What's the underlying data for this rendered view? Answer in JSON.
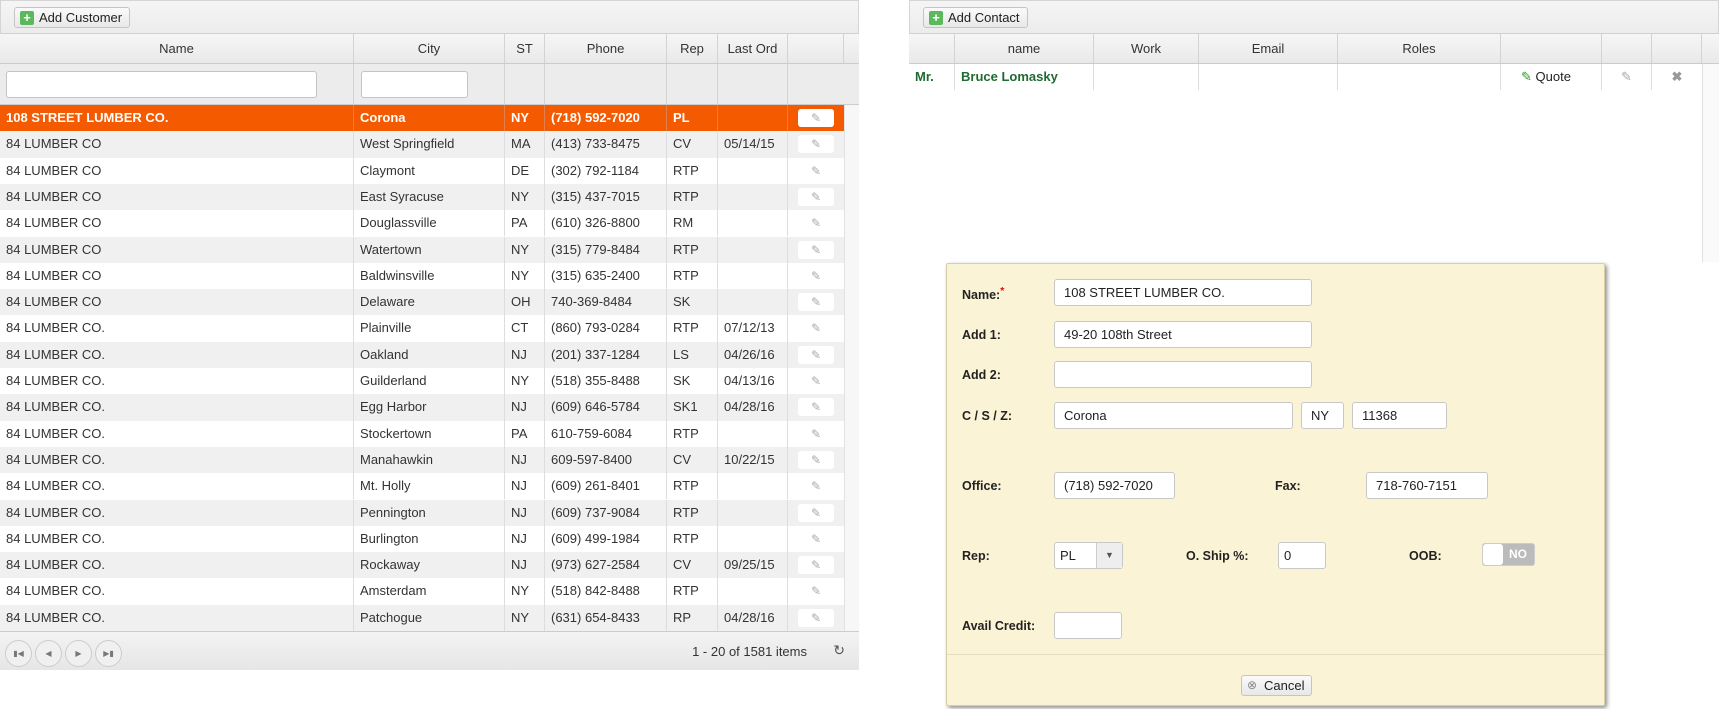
{
  "customers": {
    "add_label": "Add Customer",
    "columns": [
      "Name",
      "City",
      "ST",
      "Phone",
      "Rep",
      "Last Ord"
    ],
    "rows": [
      [
        "108 STREET LUMBER CO.",
        "Corona",
        "NY",
        "(718) 592-7020",
        "PL",
        ""
      ],
      [
        "84 LUMBER CO",
        "West Springfield",
        "MA",
        "(413) 733-8475",
        "CV",
        "05/14/15"
      ],
      [
        "84 LUMBER CO",
        "Claymont",
        "DE",
        "(302) 792-1184",
        "RTP",
        ""
      ],
      [
        "84 LUMBER CO",
        "East Syracuse",
        "NY",
        "(315) 437-7015",
        "RTP",
        ""
      ],
      [
        "84 LUMBER CO",
        "Douglassville",
        "PA",
        "(610) 326-8800",
        "RM",
        ""
      ],
      [
        "84 LUMBER CO",
        "Watertown",
        "NY",
        "(315) 779-8484",
        "RTP",
        ""
      ],
      [
        "84 LUMBER CO",
        "Baldwinsville",
        "NY",
        "(315) 635-2400",
        "RTP",
        ""
      ],
      [
        "84 LUMBER CO",
        "Delaware",
        "OH",
        "740-369-8484",
        "SK",
        ""
      ],
      [
        "84 LUMBER CO.",
        "Plainville",
        "CT",
        "(860) 793-0284",
        "RTP",
        "07/12/13"
      ],
      [
        "84 LUMBER CO.",
        "Oakland",
        "NJ",
        "(201) 337-1284",
        "LS",
        "04/26/16"
      ],
      [
        "84 LUMBER CO.",
        "Guilderland",
        "NY",
        "(518) 355-8488",
        "SK",
        "04/13/16"
      ],
      [
        "84 LUMBER CO.",
        "Egg Harbor",
        "NJ",
        "(609) 646-5784",
        "SK1",
        "04/28/16"
      ],
      [
        "84 LUMBER CO.",
        "Stockertown",
        "PA",
        "610-759-6084",
        "RTP",
        ""
      ],
      [
        "84 LUMBER CO.",
        "Manahawkin",
        "NJ",
        "609-597-8400",
        "CV",
        "10/22/15"
      ],
      [
        "84 LUMBER CO.",
        "Mt. Holly",
        "NJ",
        "(609) 261-8401",
        "RTP",
        ""
      ],
      [
        "84 LUMBER CO.",
        "Pennington",
        "NJ",
        "(609) 737-9084",
        "RTP",
        ""
      ],
      [
        "84 LUMBER CO.",
        "Burlington",
        "NJ",
        "(609) 499-1984",
        "RTP",
        ""
      ],
      [
        "84 LUMBER CO.",
        "Rockaway",
        "NJ",
        "(973) 627-2584",
        "CV",
        "09/25/15"
      ],
      [
        "84 LUMBER CO.",
        "Amsterdam",
        "NY",
        "(518) 842-8488",
        "RTP",
        ""
      ],
      [
        "84 LUMBER CO.",
        "Patchogue",
        "NY",
        "(631) 654-8433",
        "RP",
        "04/28/16"
      ]
    ],
    "selected_index": 0,
    "pager_info": "1 - 20 of 1581 items"
  },
  "contacts": {
    "add_label": "Add Contact",
    "columns": [
      "",
      "name",
      "Work",
      "Email",
      "Roles",
      "",
      "",
      ""
    ],
    "rows": [
      {
        "title": "Mr.",
        "name": "Bruce Lomasky",
        "work": "",
        "email": "",
        "roles": "",
        "quote_label": "Quote"
      }
    ]
  },
  "form": {
    "name_label": "Name:",
    "name_value": "108 STREET LUMBER CO.",
    "required_mark": "*",
    "add1_label": "Add 1:",
    "add1_value": "49-20  108th Street",
    "add2_label": "Add 2:",
    "add2_value": "",
    "csz_label": "C / S / Z:",
    "city_value": "Corona",
    "state_value": "NY",
    "zip_value": "11368",
    "office_label": "Office:",
    "office_value": "(718) 592-7020",
    "fax_label": "Fax:",
    "fax_value": "718-760-7151",
    "rep_label": "Rep:",
    "rep_value": "PL",
    "oship_label": "O. Ship %:",
    "oship_value": "0",
    "oob_label": "OOB:",
    "oob_value": "NO",
    "credit_label": "Avail Credit:",
    "credit_value": "",
    "cancel_label": "Cancel"
  },
  "colors": {
    "selected_row": "#f45a00",
    "contact_text": "#1f6b32",
    "dialog_bg": "#fbf3d5",
    "add_icon": "#5cb85c"
  }
}
